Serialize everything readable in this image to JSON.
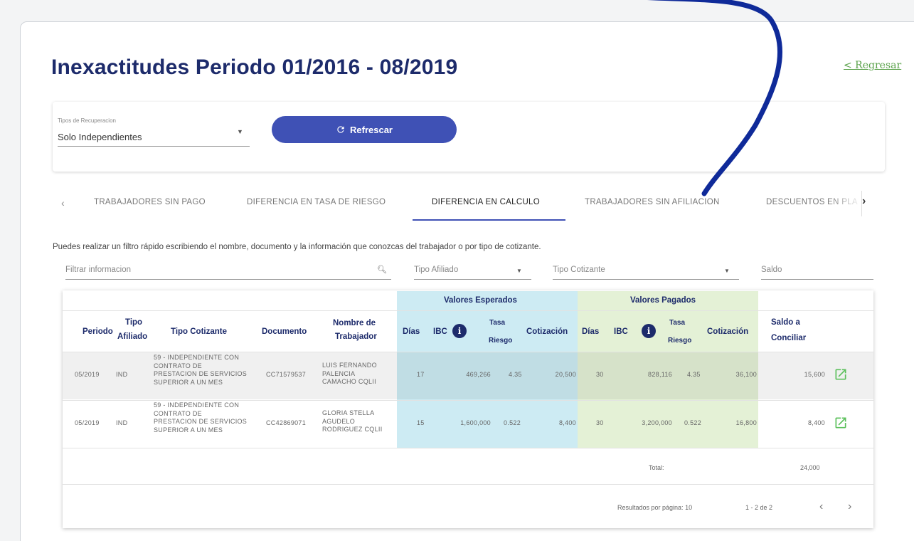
{
  "page": {
    "title": "Inexactitudes Periodo 01/2016 - 08/2019",
    "back_label": "< Regresar"
  },
  "filters": {
    "recovery_label": "Tipos de Recuperacion",
    "recovery_value": "Solo Independientes",
    "refresh_label": "Refrescar"
  },
  "tabs": [
    {
      "label": "TRABAJADORES SIN PAGO",
      "active": false
    },
    {
      "label": "DIFERENCIA EN TASA DE RIESGO",
      "active": false
    },
    {
      "label": "DIFERENCIA EN CALCULO",
      "active": true
    },
    {
      "label": "TRABAJADORES SIN AFILIACION",
      "active": false
    },
    {
      "label": "DESCUENTOS EN PLA",
      "active": false
    }
  ],
  "info_text": "Puedes realizar un filtro rápido escribiendo el nombre, documento y la información que conozcas del trabajador o por tipo de cotizante.",
  "search": {
    "filter_placeholder": "Filtrar informacion",
    "tipo_afiliado": "Tipo Afiliado",
    "tipo_cotizante": "Tipo Cotizante",
    "saldo": "Saldo"
  },
  "table": {
    "group_expected": "Valores Esperados",
    "group_paid": "Valores Pagados",
    "headers": {
      "periodo": "Periodo",
      "tipo_afiliado_1": "Tipo",
      "tipo_afiliado_2": "Afiliado",
      "tipo_cotizante": "Tipo Cotizante",
      "documento": "Documento",
      "nombre_1": "Nombre de",
      "nombre_2": "Trabajador",
      "dias": "Días",
      "ibc": "IBC",
      "tasa_1": "Tasa",
      "tasa_2": "Riesgo",
      "cotizacion": "Cotización",
      "saldo_1": "Saldo a",
      "saldo_2": "Conciliar"
    },
    "rows": [
      {
        "periodo": "05/2019",
        "tipo_afiliado": "IND",
        "tipo_cotizante": [
          "59 - INDEPENDIENTE CON",
          "CONTRATO DE",
          "PRESTACION DE SERVICIOS",
          "SUPERIOR A UN MES"
        ],
        "documento": "CC71579537",
        "nombre": [
          "LUIS FERNANDO",
          "PALENCIA",
          "CAMACHO CQLII"
        ],
        "esp_dias": "17",
        "esp_ibc": "469,266",
        "esp_tasa": "4.35",
        "esp_cotizacion": "20,500",
        "pag_dias": "30",
        "pag_ibc": "828,116",
        "pag_tasa": "4.35",
        "pag_cotizacion": "36,100",
        "saldo": "15,600"
      },
      {
        "periodo": "05/2019",
        "tipo_afiliado": "IND",
        "tipo_cotizante": [
          "59 - INDEPENDIENTE CON",
          "CONTRATO DE",
          "PRESTACION DE SERVICIOS",
          "SUPERIOR A UN MES"
        ],
        "documento": "CC42869071",
        "nombre": [
          "GLORIA STELLA",
          "AGUDELO",
          "RODRIGUEZ CQLII"
        ],
        "esp_dias": "15",
        "esp_ibc": "1,600,000",
        "esp_tasa": "0.522",
        "esp_cotizacion": "8,400",
        "pag_dias": "30",
        "pag_ibc": "3,200,000",
        "pag_tasa": "0.522",
        "pag_cotizacion": "16,800",
        "saldo": "8,400"
      }
    ],
    "total_label": "Total:",
    "total_value": "24,000"
  },
  "pagination": {
    "per_page_label": "Resultados por página: 10",
    "range": "1 - 2 de 2"
  },
  "colors": {
    "primary": "#3f51b5",
    "title": "#1d2b6b",
    "expected_bg": "#cdebf3",
    "paid_bg": "#e4f1d6",
    "edit_icon": "#5cc05c",
    "back_link": "#5aa24a",
    "annotation": "#0f2a99"
  }
}
